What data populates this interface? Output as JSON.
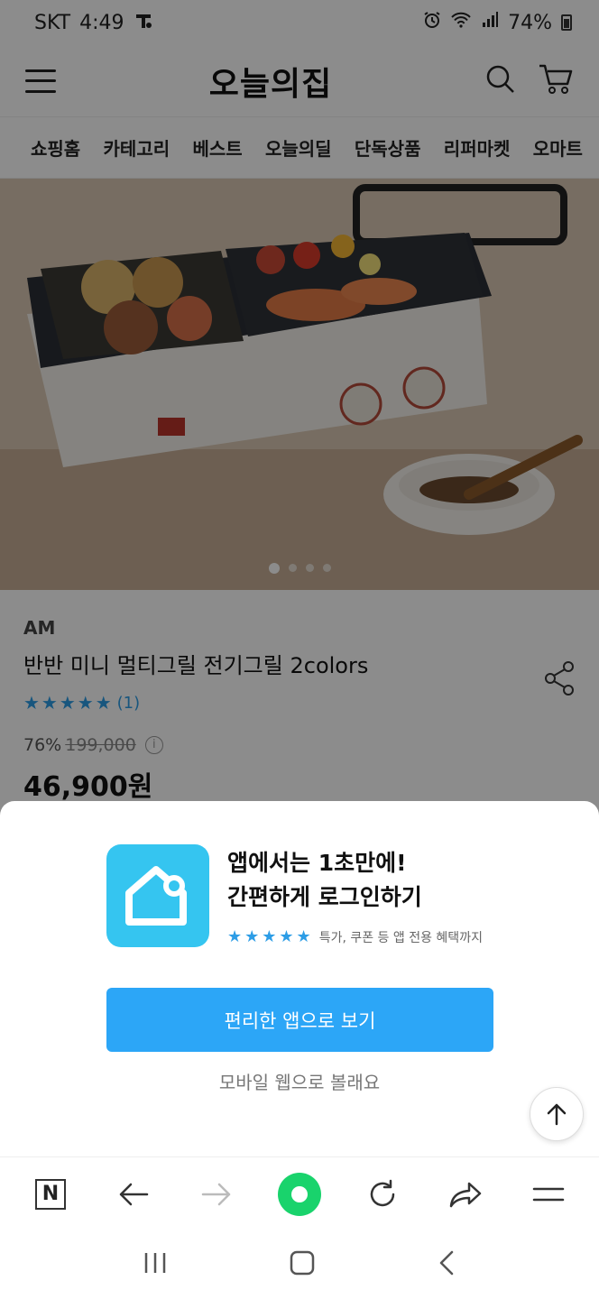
{
  "status_bar": {
    "carrier": "SKT",
    "time": "4:49",
    "battery": "74%"
  },
  "header": {
    "logo": "오늘의집"
  },
  "nav_tabs": [
    "쇼핑홈",
    "카테고리",
    "베스트",
    "오늘의딜",
    "단독상품",
    "리퍼마켓",
    "오마트"
  ],
  "hero": {
    "image_description": "electric grill product photo",
    "slides": 4,
    "active_slide": 1
  },
  "product": {
    "brand": "AM",
    "name": "반반 미니 멀티그릴 전기그릴 2colors",
    "rating_stars": 5,
    "review_count": "(1)",
    "discount": "76%",
    "original_price": "199,000",
    "price": "46,900원"
  },
  "sheet": {
    "promo_line1": "앱에서는 1초만에!",
    "promo_line2": "간편하게 로그인하기",
    "promo_sub": "특가, 쿠폰 등 앱 전용 혜택까지",
    "stars": "★★★★★",
    "app_button": "편리한 앱으로 보기",
    "web_link": "모바일 웹으로 볼래요"
  },
  "colors": {
    "accent": "#2ca6f7",
    "app_icon": "#35c5f0",
    "rating": "#2d9de6",
    "green": "#19d36c"
  }
}
